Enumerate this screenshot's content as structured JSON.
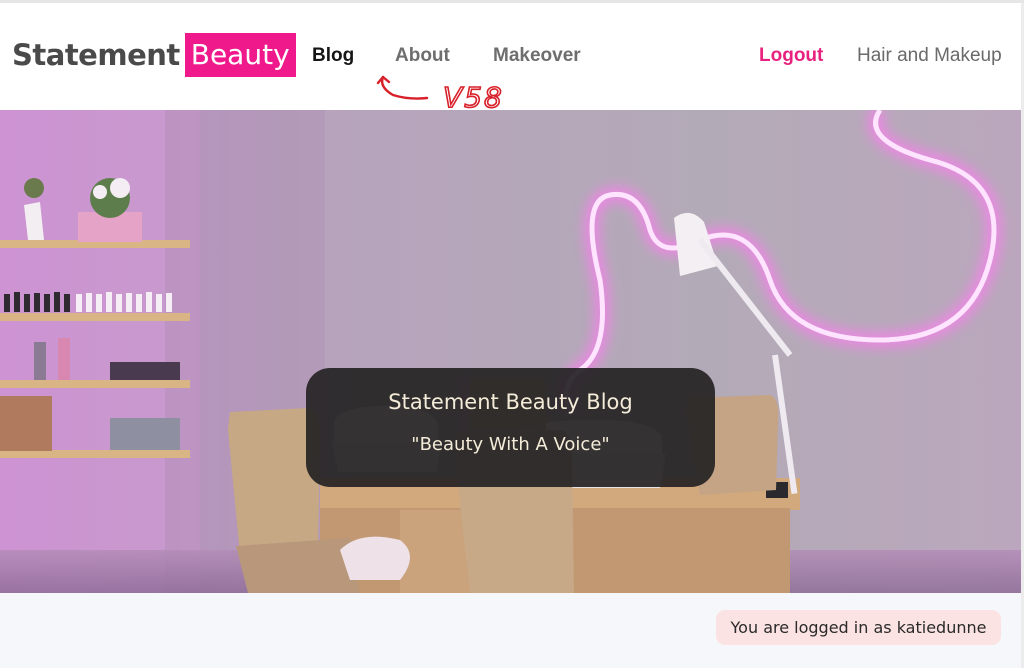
{
  "brand": {
    "name": "Statement",
    "accent": "Beauty"
  },
  "nav": {
    "blog": "Blog",
    "about": "About",
    "makeover": "Makeover",
    "logout": "Logout",
    "hair_and_makeup": "Hair and Makeup"
  },
  "annotation": {
    "text": "V58"
  },
  "hero": {
    "title": "Statement Beauty Blog",
    "tagline": "\"Beauty With A Voice\""
  },
  "status": {
    "logged_in_text": "You are logged in as katiedunne"
  },
  "colors": {
    "brand_pink": "#f0198c",
    "logout_pink": "#e8237f",
    "hero_card": "#262425",
    "hero_text": "#f4ecd8",
    "badge_bg": "#fbe3e3",
    "annotation_red": "#d8202a"
  },
  "icons": {
    "annotation_arrow": "curved-arrow-icon"
  }
}
